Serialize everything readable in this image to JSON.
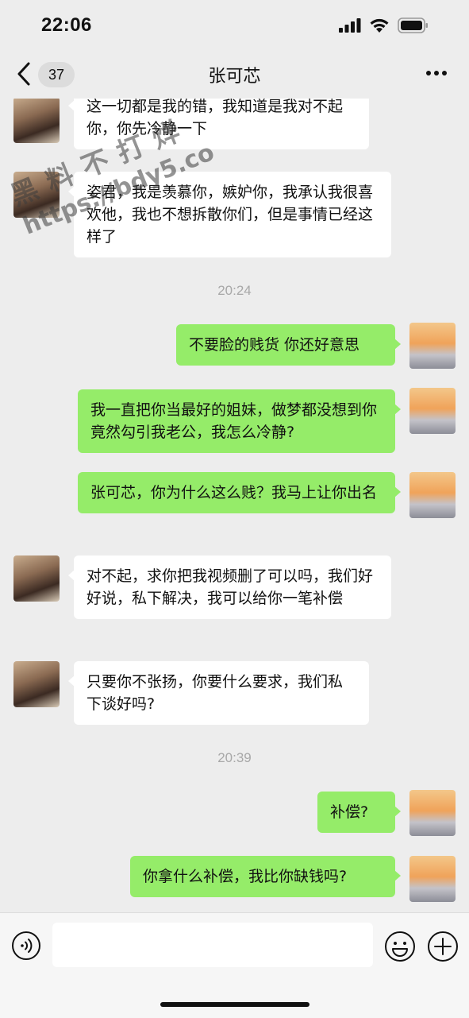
{
  "status": {
    "time": "22:06"
  },
  "nav": {
    "unread_count": "37",
    "title": "张可芯"
  },
  "messages": [
    {
      "side": "left",
      "text": "这一切都是我的错，我知道是我对不起你，你先冷静一下"
    },
    {
      "side": "left",
      "text": "姿君，我是羡慕你，嫉妒你，我承认我很喜欢他，我也不想拆散你们，但是事情已经这样了"
    },
    {
      "timestamp": "20:24"
    },
    {
      "side": "right",
      "text": "不要脸的贱货 你还好意思"
    },
    {
      "side": "right",
      "text": "我一直把你当最好的姐妹，做梦都没想到你竟然勾引我老公，我怎么冷静?"
    },
    {
      "side": "right",
      "text": "张可芯，你为什么这么贱？我马上让你出名"
    },
    {
      "side": "left",
      "text": "对不起，求你把我视频删了可以吗，我们好好说，私下解决，我可以给你一笔补偿"
    },
    {
      "side": "left",
      "text": "只要你不张扬，你要什么要求，我们私下谈好吗?"
    },
    {
      "timestamp": "20:39"
    },
    {
      "side": "right",
      "text": "补偿?"
    },
    {
      "side": "right",
      "text": "你拿什么补偿，我比你缺钱吗?"
    }
  ],
  "watermark": {
    "line1": "黑料不打烊",
    "line2": "https://bdy5.co"
  },
  "input": {
    "value": ""
  },
  "colors": {
    "self_bubble": "#95ec69",
    "peer_bubble": "#ffffff",
    "background": "#ededed"
  }
}
